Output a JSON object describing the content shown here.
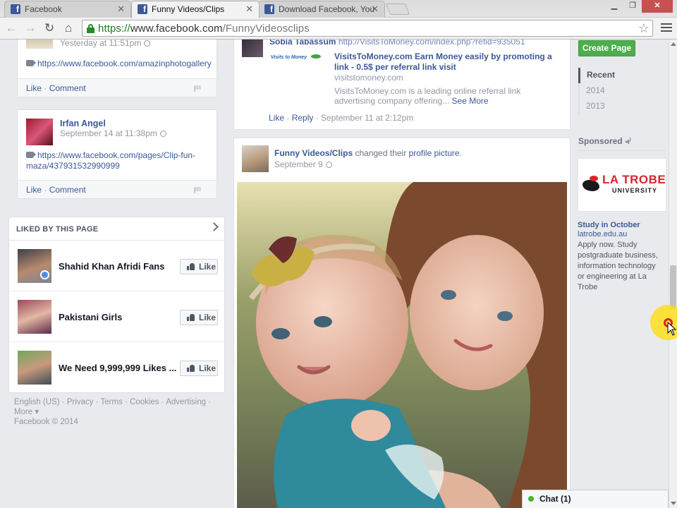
{
  "browser": {
    "tabs": [
      {
        "title": "Facebook",
        "active": false
      },
      {
        "title": "Funny Videos/Clips",
        "active": true
      },
      {
        "title": "Download Facebook, You",
        "active": false
      }
    ],
    "url": {
      "scheme": "https://",
      "host": "www.facebook.com",
      "path": "/FunnyVideosclips"
    },
    "icons": [
      "back-icon",
      "forward-icon",
      "reload-icon",
      "home-icon",
      "lock-icon",
      "star-icon",
      "menu-icon"
    ]
  },
  "left_column": {
    "post1": {
      "time": "Yesterday at 11:51pm",
      "link": "https://www.facebook.com/amazinphotogallery",
      "like": "Like",
      "comment": "Comment"
    },
    "post2": {
      "author": "Irfan Angel",
      "time": "September 14 at 11:38pm",
      "link_line1": "https://www.facebook.com/pages/Clip-fun-",
      "link_line2": "maza/437931532990999",
      "like": "Like",
      "comment": "Comment"
    },
    "liked": {
      "heading": "LIKED BY THIS PAGE",
      "items": [
        {
          "name": "Shahid Khan Afridi Fans",
          "button": "Like"
        },
        {
          "name": "Pakistani Girls",
          "button": "Like"
        },
        {
          "name": "We Need 9,999,999 Likes ...",
          "button": "Like"
        }
      ]
    },
    "footer": {
      "links": [
        "English (US)",
        "Privacy",
        "Terms",
        "Cookies",
        "Advertising"
      ],
      "more": "More",
      "copyright": "Facebook © 2014"
    }
  },
  "center_column": {
    "comment": {
      "author": "Sobia Tabassum",
      "url": "http://VisitsToMoney.com/index.php?refid=935051",
      "preview_logo": "Visits to Money",
      "preview_title": "VisitsToMoney.com Earn Money easily by promoting a link - 0.5$ per referral link visit",
      "preview_domain": "visitstomoney.com",
      "preview_desc": "VisitsToMoney.com is a leading online referral link advertising company offering...",
      "see_more": "See More",
      "like": "Like",
      "reply": "Reply",
      "time": "September 11 at 2:12pm"
    },
    "post": {
      "author": "Funny Videos/Clips",
      "action": "changed their",
      "object": "profile picture",
      "time": "September 9"
    }
  },
  "right_column": {
    "create_page": "Create Page",
    "years": [
      {
        "label": "Recent",
        "selected": true
      },
      {
        "label": "2014",
        "selected": false
      },
      {
        "label": "2013",
        "selected": false
      }
    ],
    "sponsored": "Sponsored",
    "ad": {
      "logo_line1": "LA TROBE",
      "logo_line2": "UNIVERSITY",
      "title": "Study in October",
      "url": "latrobe.edu.au",
      "body": "Apply now. Study postgraduate business, information technology or engineering at La Trobe"
    }
  },
  "chat": {
    "label": "Chat (1)"
  },
  "colors": {
    "facebook_blue": "#3b5998",
    "create_green": "#4cae4c",
    "page_bg": "#e9eaed"
  }
}
